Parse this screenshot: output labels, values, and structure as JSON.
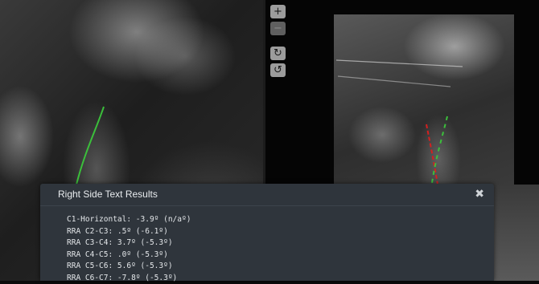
{
  "viewer": {
    "left_image": "lateral cervical x-ray (left)",
    "right_image": "lateral cervical x-ray (right)"
  },
  "toolbar": {
    "zoom_in_label": "+",
    "zoom_out_label": "−",
    "rotate_cw_label": "↻",
    "rotate_ccw_label": "↺"
  },
  "overlay_colors": {
    "green": "#3bbf3b",
    "red": "#d42020"
  },
  "modal": {
    "title": "Right Side Text Results",
    "close_label": "✖",
    "lines": [
      "C1-Horizontal: -3.9º (n/aº)",
      "RRA C2-C3: .5º (-6.1º)",
      "RRA C3-C4: 3.7º (-5.3º)",
      "RRA C4-C5: .0º (-5.3º)",
      "RRA C5-C6: 5.6º (-5.3º)",
      "RRA C6-C7: -7.8º (-5.3º)"
    ]
  }
}
